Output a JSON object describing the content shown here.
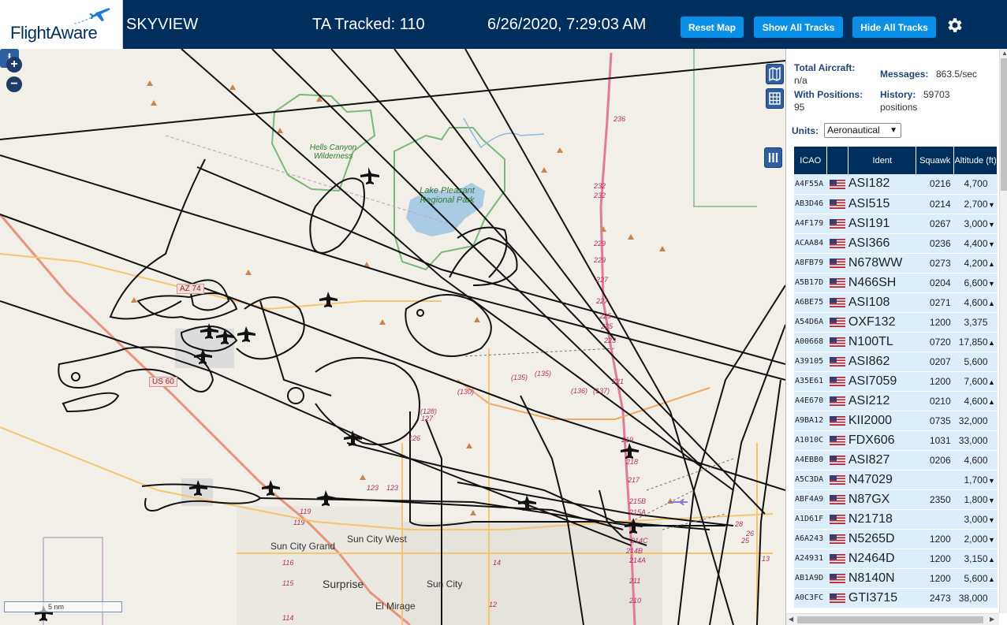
{
  "header": {
    "logo_text": "FlightAware",
    "title": "SKYVIEW",
    "tracked": "TA Tracked: 110",
    "datetime": "6/26/2020, 7:29:03 AM",
    "buttons": {
      "reset": "Reset Map",
      "show_all": "Show All Tracks",
      "hide_all": "Hide All Tracks"
    },
    "settings_icon": "gear-icon",
    "colors": {
      "bar": "#002f5d",
      "button": "#0a90e6"
    }
  },
  "map": {
    "zoom_in": "+",
    "zoom_out": "−",
    "scale": "5 nm",
    "info_button": "i",
    "places": [
      "Sun City Grand",
      "Sun City West",
      "Surprise",
      "Sun City",
      "El Mirage"
    ],
    "parks": [
      "Hells Canyon Wilderness",
      "Lake Pleasant Regional Park"
    ],
    "roads": [
      "AZ 74",
      "US 60"
    ],
    "mile_markers": [
      "236",
      "232",
      "232",
      "229",
      "229",
      "227",
      "227",
      "225",
      "225",
      "223",
      "221",
      "219",
      "218",
      "217",
      "215B",
      "215A",
      "214C",
      "214B",
      "214A",
      "211",
      "210",
      "123",
      "123",
      "119",
      "119",
      "116",
      "115",
      "114",
      "14",
      "13",
      "12",
      "28",
      "26",
      "25",
      "(135)",
      "(135)",
      "(130)",
      "(128)",
      "127",
      "126",
      "(136)",
      "(137)"
    ]
  },
  "stats": {
    "total_label": "Total Aircraft:",
    "total_value": "n/a",
    "messages_label": "Messages:",
    "messages_value": "863.5/sec",
    "positions_label": "With Positions:",
    "positions_value": "95",
    "history_label": "History:",
    "history_value": "59703",
    "history_unit": "positions",
    "units_label": "Units:",
    "units_value": "Aeronautical"
  },
  "table": {
    "headers": {
      "icao": "ICAO",
      "flag": "",
      "ident": "Ident",
      "squawk": "Squawk",
      "altitude": "Altitude (ft)"
    },
    "rows": [
      {
        "icao": "A4F55A",
        "ident": "ASI182",
        "squawk": "0216",
        "altitude": "4,700",
        "trend": ""
      },
      {
        "icao": "AB3D46",
        "ident": "ASI515",
        "squawk": "0214",
        "altitude": "2,700",
        "trend": "▼"
      },
      {
        "icao": "A4F179",
        "ident": "ASI191",
        "squawk": "0267",
        "altitude": "3,000",
        "trend": "▼"
      },
      {
        "icao": "ACAA84",
        "ident": "ASI366",
        "squawk": "0236",
        "altitude": "4,400",
        "trend": "▼"
      },
      {
        "icao": "A8FB79",
        "ident": "N678WW",
        "squawk": "0273",
        "altitude": "4,200",
        "trend": "▲"
      },
      {
        "icao": "A5B17D",
        "ident": "N466SH",
        "squawk": "0204",
        "altitude": "6,600",
        "trend": "▼"
      },
      {
        "icao": "A6BE75",
        "ident": "ASI108",
        "squawk": "0271",
        "altitude": "4,600",
        "trend": "▲"
      },
      {
        "icao": "A54D6A",
        "ident": "OXF132",
        "squawk": "1200",
        "altitude": "3,375",
        "trend": ""
      },
      {
        "icao": "A00668",
        "ident": "N100TL",
        "squawk": "0720",
        "altitude": "17,850",
        "trend": "▲"
      },
      {
        "icao": "A39105",
        "ident": "ASI862",
        "squawk": "0207",
        "altitude": "5,600",
        "trend": ""
      },
      {
        "icao": "A35E61",
        "ident": "ASI7059",
        "squawk": "1200",
        "altitude": "7,600",
        "trend": "▲"
      },
      {
        "icao": "A4E670",
        "ident": "ASI212",
        "squawk": "0210",
        "altitude": "4,600",
        "trend": "▲"
      },
      {
        "icao": "A9BA12",
        "ident": "KII2000",
        "squawk": "0735",
        "altitude": "32,000",
        "trend": ""
      },
      {
        "icao": "A1010C",
        "ident": "FDX606",
        "squawk": "1031",
        "altitude": "33,000",
        "trend": ""
      },
      {
        "icao": "A4EBB0",
        "ident": "ASI827",
        "squawk": "0206",
        "altitude": "4,600",
        "trend": ""
      },
      {
        "icao": "A5C3DA",
        "ident": "N47029",
        "squawk": "",
        "altitude": "1,700",
        "trend": "▼"
      },
      {
        "icao": "ABF4A9",
        "ident": "N87GX",
        "squawk": "2350",
        "altitude": "1,800",
        "trend": "▼"
      },
      {
        "icao": "A1D61F",
        "ident": "N21718",
        "squawk": "",
        "altitude": "3,000",
        "trend": "▼"
      },
      {
        "icao": "A6A243",
        "ident": "N5265D",
        "squawk": "1200",
        "altitude": "2,000",
        "trend": "▼"
      },
      {
        "icao": "A24931",
        "ident": "N2464D",
        "squawk": "1200",
        "altitude": "3,150",
        "trend": "▲"
      },
      {
        "icao": "AB1A9D",
        "ident": "N8140N",
        "squawk": "1200",
        "altitude": "5,600",
        "trend": "▲"
      },
      {
        "icao": "A0C3FC",
        "ident": "GTI3715",
        "squawk": "2473",
        "altitude": "38,000",
        "trend": ""
      }
    ]
  }
}
